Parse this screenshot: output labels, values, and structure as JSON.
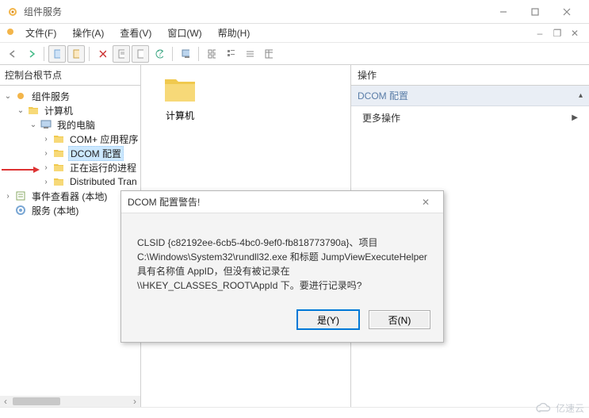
{
  "window": {
    "title": "组件服务"
  },
  "menu": {
    "file": "文件(F)",
    "action": "操作(A)",
    "view": "查看(V)",
    "window": "窗口(W)",
    "help": "帮助(H)"
  },
  "tree": {
    "header": "控制台根节点",
    "root": "组件服务",
    "n_computer": "计算机",
    "n_mypc": "我的电脑",
    "n_complus": "COM+ 应用程序",
    "n_dcom": "DCOM 配置",
    "n_running": "正在运行的进程",
    "n_dtc": "Distributed Tran",
    "n_eventviewer": "事件查看器 (本地)",
    "n_services": "服务 (本地)"
  },
  "content": {
    "item1": "计算机"
  },
  "actions": {
    "header": "操作",
    "group": "DCOM 配置",
    "more": "更多操作"
  },
  "dialog": {
    "title": "DCOM 配置警告!",
    "body": "CLSID {c82192ee-6cb5-4bc0-9ef0-fb818773790a}、项目 C:\\Windows\\System32\\rundll32.exe 和标题 JumpViewExecuteHelper 具有名称值 AppID，但没有被记录在 \\\\HKEY_CLASSES_ROOT\\AppId 下。要进行记录吗?",
    "yes": "是(Y)",
    "no": "否(N)"
  },
  "watermark": "亿速云"
}
